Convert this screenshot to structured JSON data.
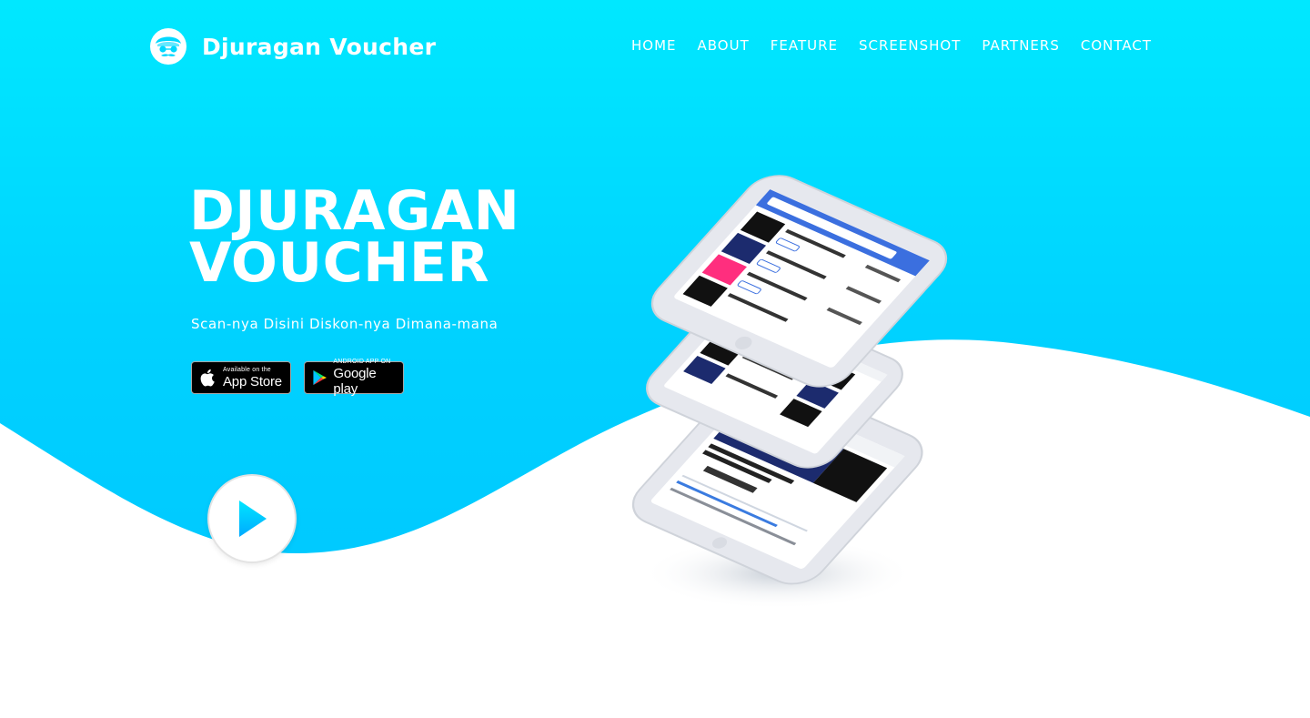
{
  "brand": {
    "name": "Djuragan Voucher",
    "logo_icon": "turban-face-icon"
  },
  "nav": {
    "items": [
      {
        "label": "HOME"
      },
      {
        "label": "ABOUT"
      },
      {
        "label": "FEATURE"
      },
      {
        "label": "SCREENSHOT"
      },
      {
        "label": "PARTNERS"
      },
      {
        "label": "CONTACT"
      }
    ]
  },
  "hero": {
    "title_line1": "DJURAGAN",
    "title_line2": "VOUCHER",
    "subtitle": "Scan-nya Disini Diskon-nya Dimana-mana"
  },
  "store_buttons": {
    "apple": {
      "small": "Available on the",
      "big": "App Store",
      "icon": "apple-icon"
    },
    "google": {
      "small": "ANDROID APP ON",
      "big": "Google play",
      "icon": "google-play-icon"
    }
  },
  "play_button": {
    "icon": "play-icon"
  },
  "colors": {
    "hero_top": "#00e8ff",
    "hero_bottom": "#00c4ff",
    "play_accent": "#00c6ff",
    "text": "#ffffff"
  }
}
